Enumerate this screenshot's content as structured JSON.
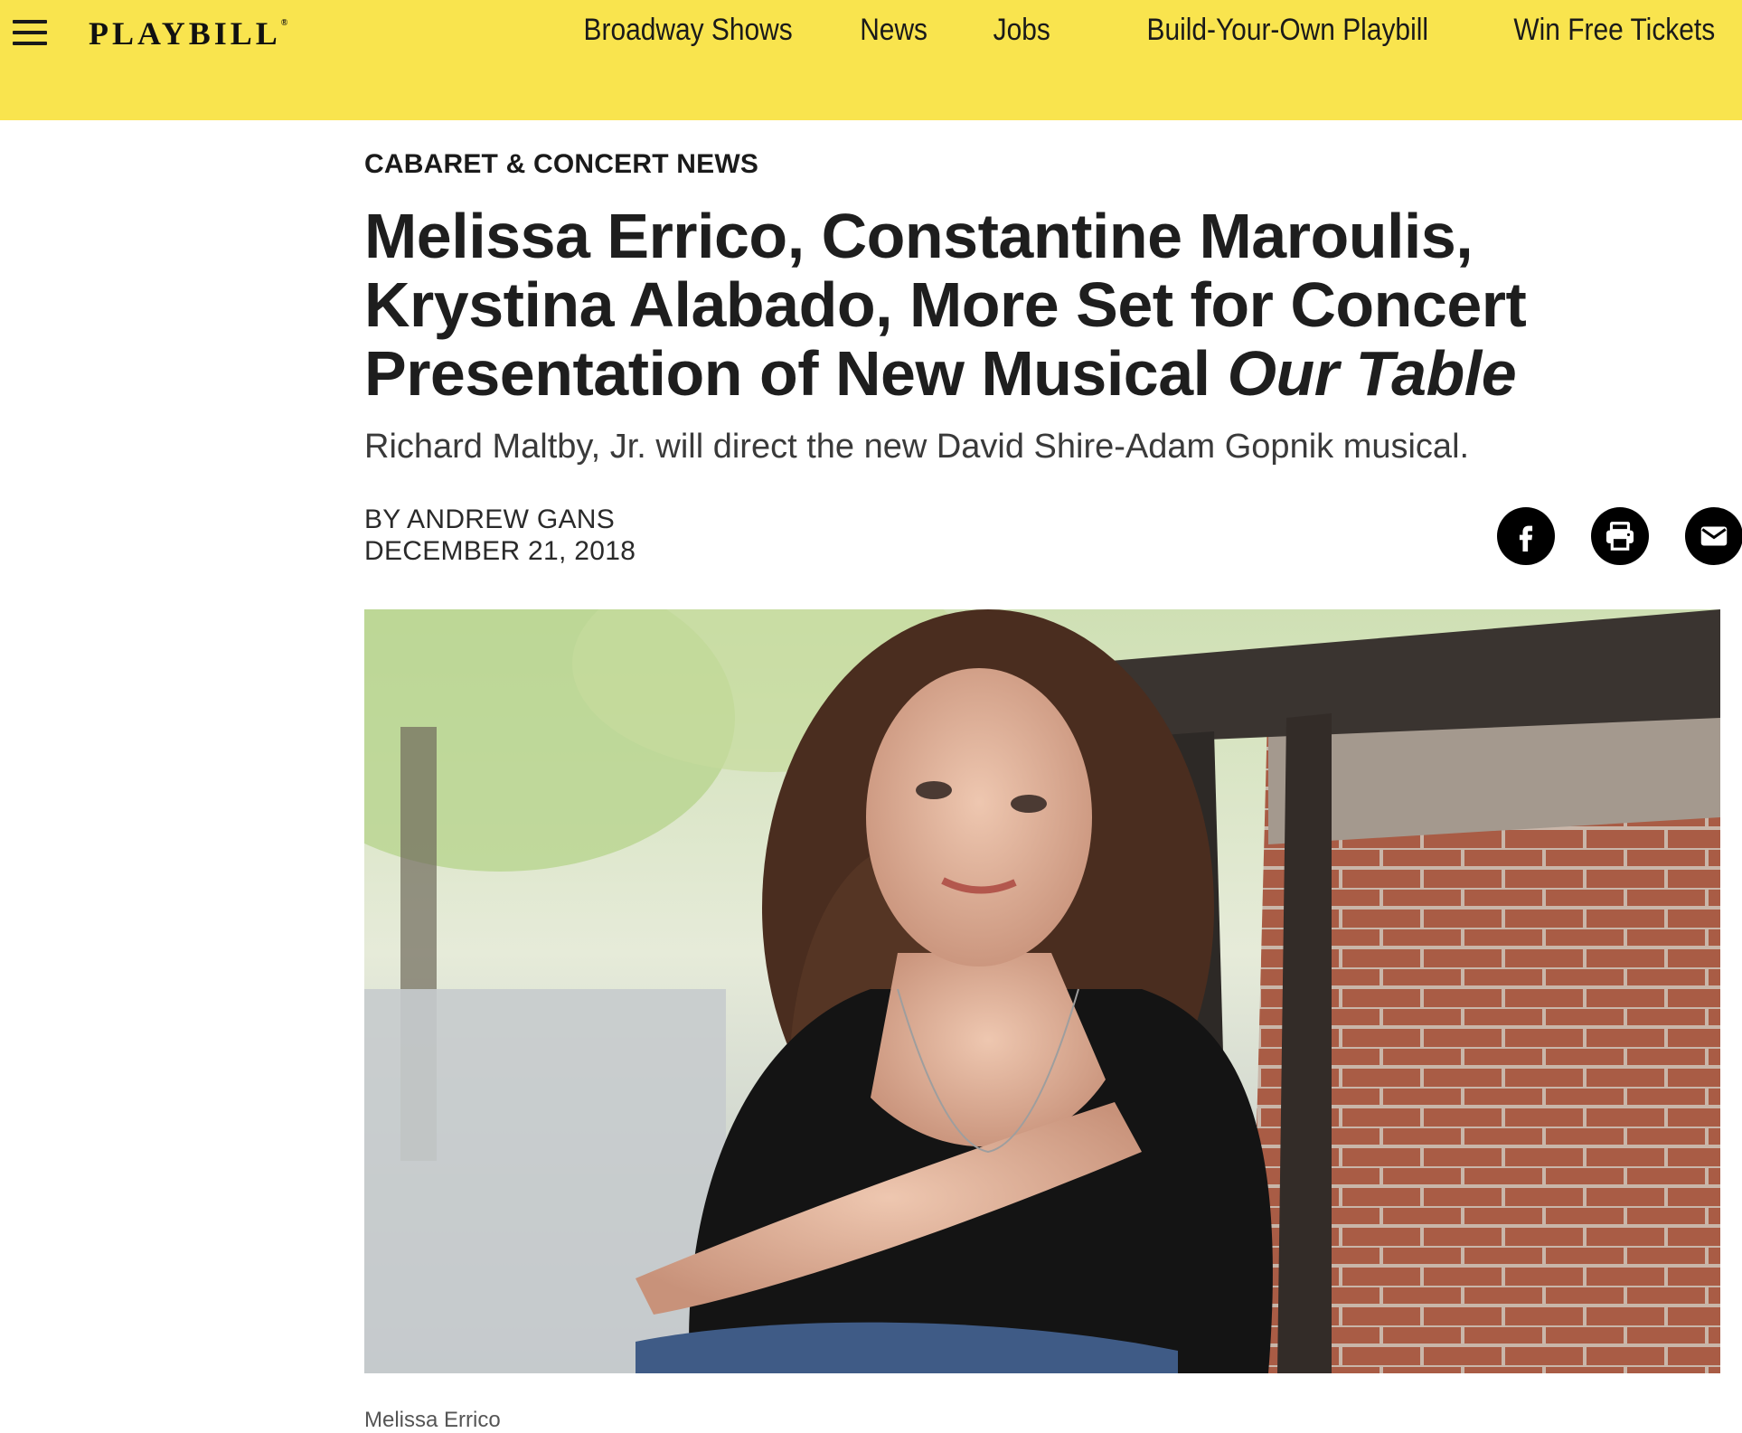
{
  "header": {
    "logo_text": "PLAYBILL",
    "logo_mark": "®",
    "nav": [
      "Broadway Shows",
      "News",
      "Jobs",
      "Build-Your-Own Playbill",
      "Win Free Tickets"
    ],
    "bar_color": "#f9e44e"
  },
  "article": {
    "kicker": "CABARET & CONCERT NEWS",
    "headline_plain": "Melissa Errico, Constantine Maroulis, Krystina Alabado, More Set for Concert Presentation of New Musical ",
    "headline_italic": "Our Table",
    "dek": "Richard Maltby, Jr. will direct the new David Shire-Adam Gopnik musical.",
    "byline": "BY ANDREW GANS",
    "date": "DECEMBER 21, 2018",
    "share_icons": [
      "facebook-icon",
      "print-icon",
      "email-icon"
    ],
    "photo_caption": "Melissa Errico"
  }
}
